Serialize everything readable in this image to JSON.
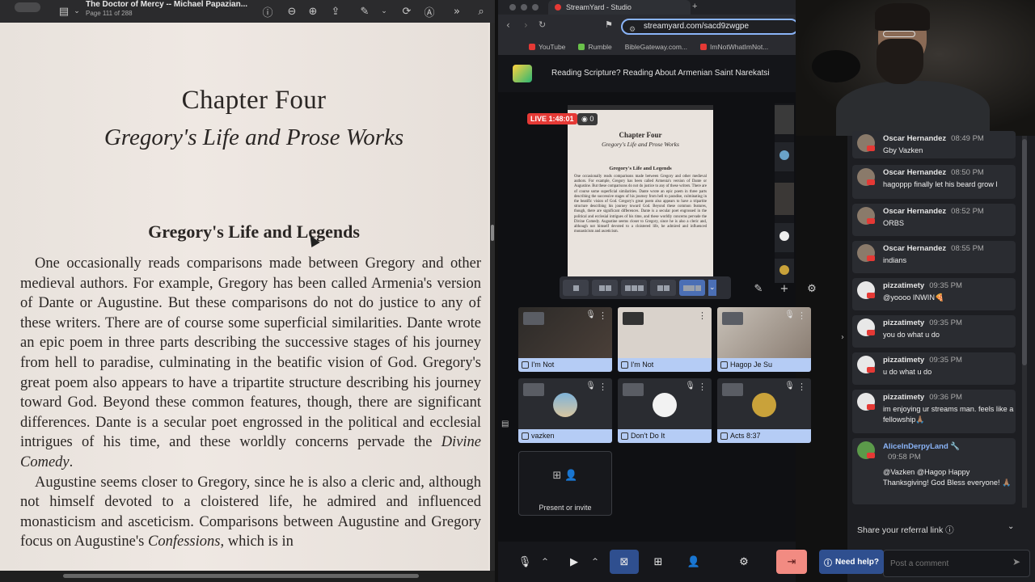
{
  "reader": {
    "title": "The Doctor of Mercy -- Michael Papazian...",
    "page_indicator": "Page 111 of 288",
    "chapter": "Chapter Four",
    "subtitle": "Gregory's Life and Prose Works",
    "section": "Gregory's Life and Legends",
    "paragraphs": [
      "One occasionally reads comparisons made between Gregory and other medieval authors. For example, Gregory has been called Armenia's version of Dante or Augustine. But these comparisons do not do justice to any of these writers. There are of course some superficial similarities. Dante wrote an epic poem in three parts describing the successive stages of his journey from hell to paradise, culminating in the beatific vision of God. Gregory's great poem also appears to have a tripartite structure describing his journey toward God. Beyond these common features, though, there are significant differences. Dante is a secular poet engrossed in the political and ecclesial intrigues of his time, and these worldly concerns pervade the",
      "Augustine seems closer to Gregory, since he is also a cleric and, although not himself devoted to a cloistered life, he admired and influenced monasticism and asceticism. Comparisons between Augustine and Gregory focus on Augustine's"
    ],
    "italic_1": "Divine Comedy",
    "after_italic_1": ".",
    "italic_2": "Confessions",
    "after_italic_2": ", which is in"
  },
  "browser": {
    "tab_title": "StreamYard - Studio",
    "url": "streamyard.com/sacd9zwgpe",
    "bookmarks": [
      "YouTube",
      "Rumble",
      "BibleGateway.com...",
      "ImNotWhatImNot..."
    ],
    "broadcast_title": "Reading Scripture? Reading About Armenian Saint Narekatsi",
    "live_label": "LIVE 1:48:01",
    "viewer_count": "0",
    "preview": {
      "chapter": "Chapter Four",
      "subtitle": "Gregory's Life and Prose Works",
      "section": "Gregory's Life and Legends",
      "body": "One occasionally reads comparisons made between Gregory and other medieval authors. For example, Gregory has been called Armenia's version of Dante or Augustine. But these comparisons do not do justice to any of these writers. There are of course some superficial similarities. Dante wrote an epic poem in three parts describing the successive stages of his journey from hell to paradise, culminating in the beatific vision of God. Gregory's great poem also appears to have a tripartite structure describing his journey toward God. Beyond these common features, though, there are significant differences. Dante is a secular poet engrossed in the political and ecclesial intrigues of his time, and these worldly concerns pervade the Divine Comedy. Augustine seems closer to Gregory, since he is also a cleric and, although not himself devoted to a cloistered life, he admired and influenced monasticism and asceticism."
    },
    "tiles": [
      {
        "name": "I'm Not",
        "kind": "camera"
      },
      {
        "name": "I'm Not",
        "kind": "screen"
      },
      {
        "name": "Hagop Je Su",
        "kind": "camera"
      },
      {
        "name": "vazken",
        "kind": "avatar"
      },
      {
        "name": "Don't Do It",
        "kind": "avatar"
      },
      {
        "name": "Acts 8:37",
        "kind": "avatar"
      }
    ],
    "present_label": "Present or invite",
    "help_label": "Need help?"
  },
  "chat": {
    "messages": [
      {
        "name": "Oscar Hernandez",
        "time": "08:49 PM",
        "text": "Gby Vazken"
      },
      {
        "name": "Oscar Hernandez",
        "time": "08:50 PM",
        "text": "hagoppp finally let his beard grow l"
      },
      {
        "name": "Oscar Hernandez",
        "time": "08:52 PM",
        "text": "ORBS"
      },
      {
        "name": "Oscar Hernandez",
        "time": "08:55 PM",
        "text": "indians"
      },
      {
        "name": "pizzatimety",
        "time": "09:35 PM",
        "text": "@yoooo INWIN🍕"
      },
      {
        "name": "pizzatimety",
        "time": "09:35 PM",
        "text": "you do what u do"
      },
      {
        "name": "pizzatimety",
        "time": "09:35 PM",
        "text": "u do what u do"
      },
      {
        "name": "pizzatimety",
        "time": "09:36 PM",
        "text": "im enjoying ur streams man. feels like a fellowship🙏🏽"
      },
      {
        "name": "AliceInDerpyLand",
        "time": "09:58 PM",
        "text": "@Vazken @Hagop Happy Thanksgiving! God Bless everyone! 🙏🏽"
      }
    ],
    "referral": "Share your referral link",
    "input_placeholder": "Post a comment"
  },
  "colors": {
    "live": "#e53935",
    "accent": "#8ab4f8",
    "tile_label": "#b5ccf5",
    "leave": "#f28b82"
  }
}
